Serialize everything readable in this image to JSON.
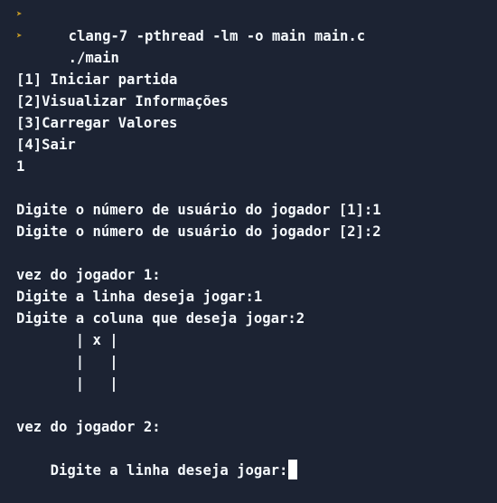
{
  "colors": {
    "background": "#1c2333",
    "text": "#f5f9fc",
    "prompt_icon": "#c49a26",
    "cursor": "#ffffff"
  },
  "prompt_icon": "prompt-chevron-icon",
  "commands": [
    "clang-7 -pthread -lm -o main main.c",
    "./main"
  ],
  "output": [
    "",
    "[1] Iniciar partida",
    "[2]Visualizar Informações",
    "[3]Carregar Valores",
    "[4]Sair",
    "1",
    "",
    "Digite o número de usuário do jogador [1]:1",
    "Digite o número de usuário do jogador [2]:2",
    "",
    "vez do jogador 1:",
    "Digite a linha deseja jogar:1",
    "Digite a coluna que deseja jogar:2",
    "       | x |",
    "       |   |",
    "       |   |",
    "",
    "vez do jogador 2:"
  ],
  "input_prompt": "Digite a linha deseja jogar:",
  "input_value": ""
}
